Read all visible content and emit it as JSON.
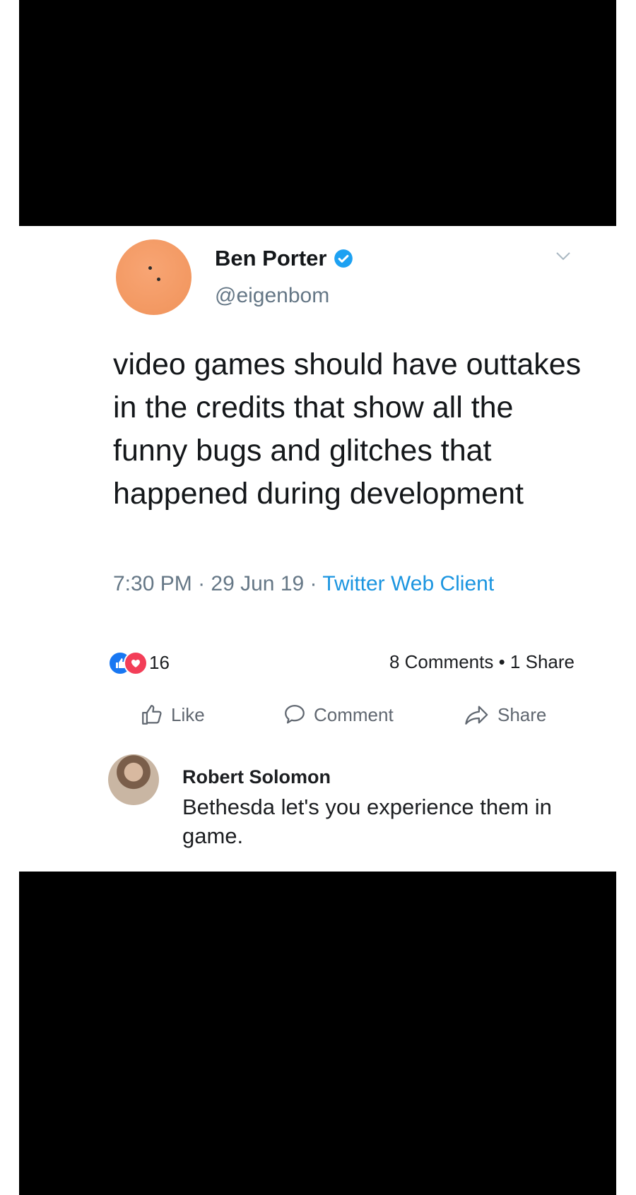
{
  "tweet": {
    "author_name": "Ben Porter",
    "handle": "@eigenbom",
    "text": "video games should have outtakes in the credits that show all the funny bugs and glitches that happened during development",
    "time": "7:30 PM",
    "date": "29 Jun 19",
    "client": "Twitter Web Client",
    "separator": " · "
  },
  "post": {
    "reaction_count": "16",
    "comments_label": "8 Comments",
    "shares_label": "1 Share",
    "counts_separator": " • "
  },
  "actions": {
    "like": "Like",
    "comment": "Comment",
    "share": "Share"
  },
  "comment": {
    "author": "Robert Solomon",
    "text": "Bethesda let's you experience them in game."
  },
  "colors": {
    "verified": "#1da1f2",
    "link": "#1b95e0",
    "like_badge": "#1877f2",
    "love_badge": "#f33e58",
    "avatar": "#f49a62"
  }
}
